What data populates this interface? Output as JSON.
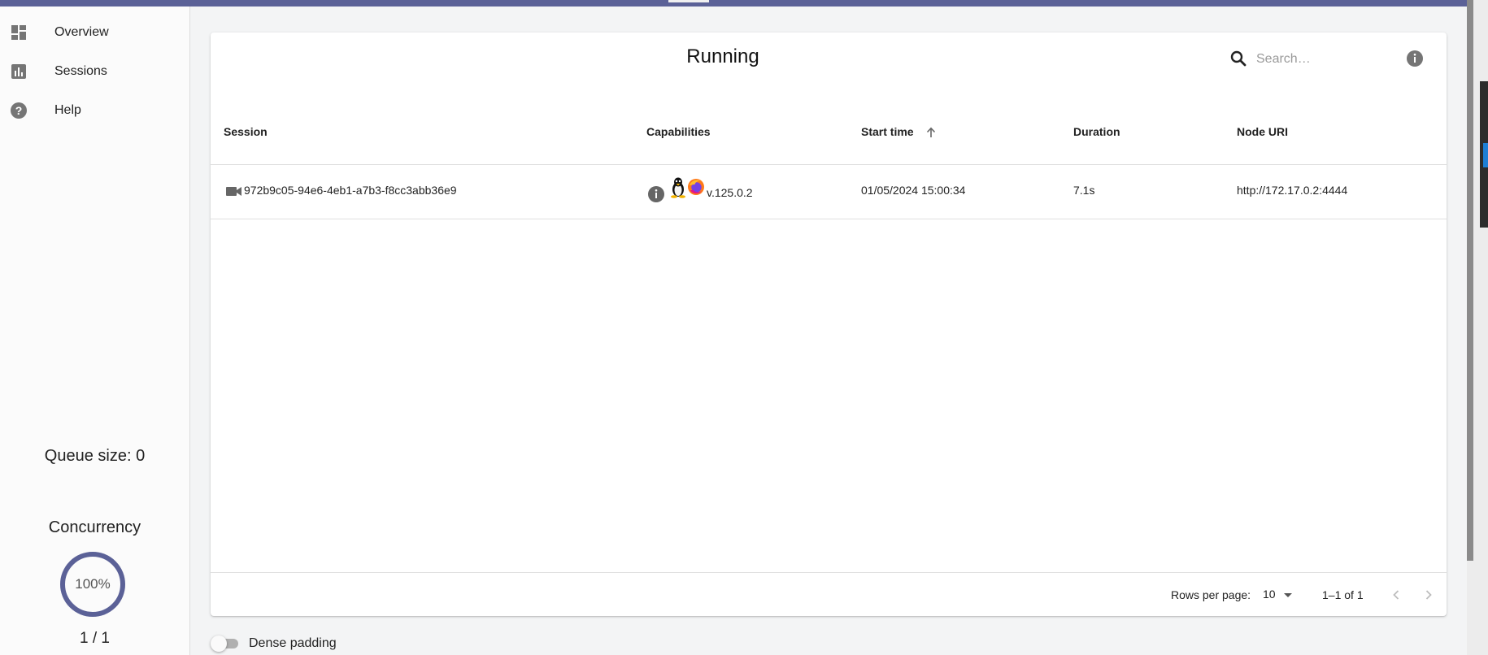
{
  "sidebar": {
    "items": [
      {
        "label": "Overview",
        "icon": "dashboard-icon"
      },
      {
        "label": "Sessions",
        "icon": "assessment-icon"
      },
      {
        "label": "Help",
        "icon": "help-icon"
      }
    ],
    "queue_size": "Queue size: 0",
    "concurrency_title": "Concurrency",
    "concurrency_percent": "100%",
    "concurrency_value": 1.0,
    "concurrency_count": "1 / 1"
  },
  "main": {
    "title": "Running",
    "search_placeholder": "Search…",
    "table": {
      "headers": {
        "session": "Session",
        "capabilities": "Capabilities",
        "start_time": "Start time",
        "duration": "Duration",
        "node_uri": "Node URI"
      },
      "rows": [
        {
          "session_id": "972b9c05-94e6-4eb1-a7b3-f8cc3abb36e9",
          "capabilities_version": "v.125.0.2",
          "start_time": "01/05/2024 15:00:34",
          "duration": "7.1s",
          "node_uri": "http://172.17.0.2:4444"
        }
      ]
    },
    "pagination": {
      "rows_per_page_label": "Rows per page:",
      "rows_per_page": "10",
      "range": "1–1 of 1"
    },
    "dense_padding_label": "Dense padding"
  },
  "colors": {
    "accent": "#5b6197",
    "icon_gray": "#757575"
  }
}
